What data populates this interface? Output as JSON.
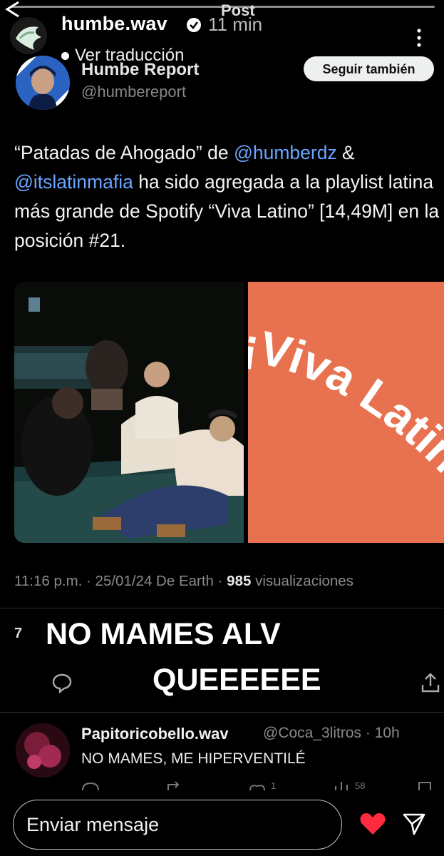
{
  "story": {
    "title": "Post",
    "username": "humbe.wav",
    "time": "11 min",
    "translate_label": "Ver traducción"
  },
  "tweet": {
    "name": "Humbe Report",
    "handle": "@humbereport",
    "follow_label": "Seguir también",
    "text_1": "“Patadas de Ahogado” de ",
    "mention_1": "@humberdz",
    "text_2": " & ",
    "mention_2": "@itslatinmafia",
    "text_3": " ha sido agregada a la playlist latina más grande de Spotify “Viva Latino” [14,49M] en la posición #21.",
    "playlist_cover_text": "¡Viva Latin",
    "meta_time": "11:16 p.m. · 25/01/24 De Earth · ",
    "meta_views_count": "985",
    "meta_views_label": " visualizaciones",
    "count_partial": "7"
  },
  "stickers": {
    "line_1": "NO MAMES ALV",
    "line_2": "QUEEEEEE"
  },
  "reply": {
    "username": "Papitoricobello.wav",
    "handle": "@Coca_3litros · 10h",
    "text": "NO MAMES, ME HIPERVENTILÉ",
    "like_count": "1",
    "views_count": "58"
  },
  "message_bar": {
    "placeholder": "Enviar mensaje"
  },
  "colors": {
    "mention": "#6aa4ff",
    "playlist_bg": "#e8714f",
    "heart": "#ff2b3f"
  }
}
